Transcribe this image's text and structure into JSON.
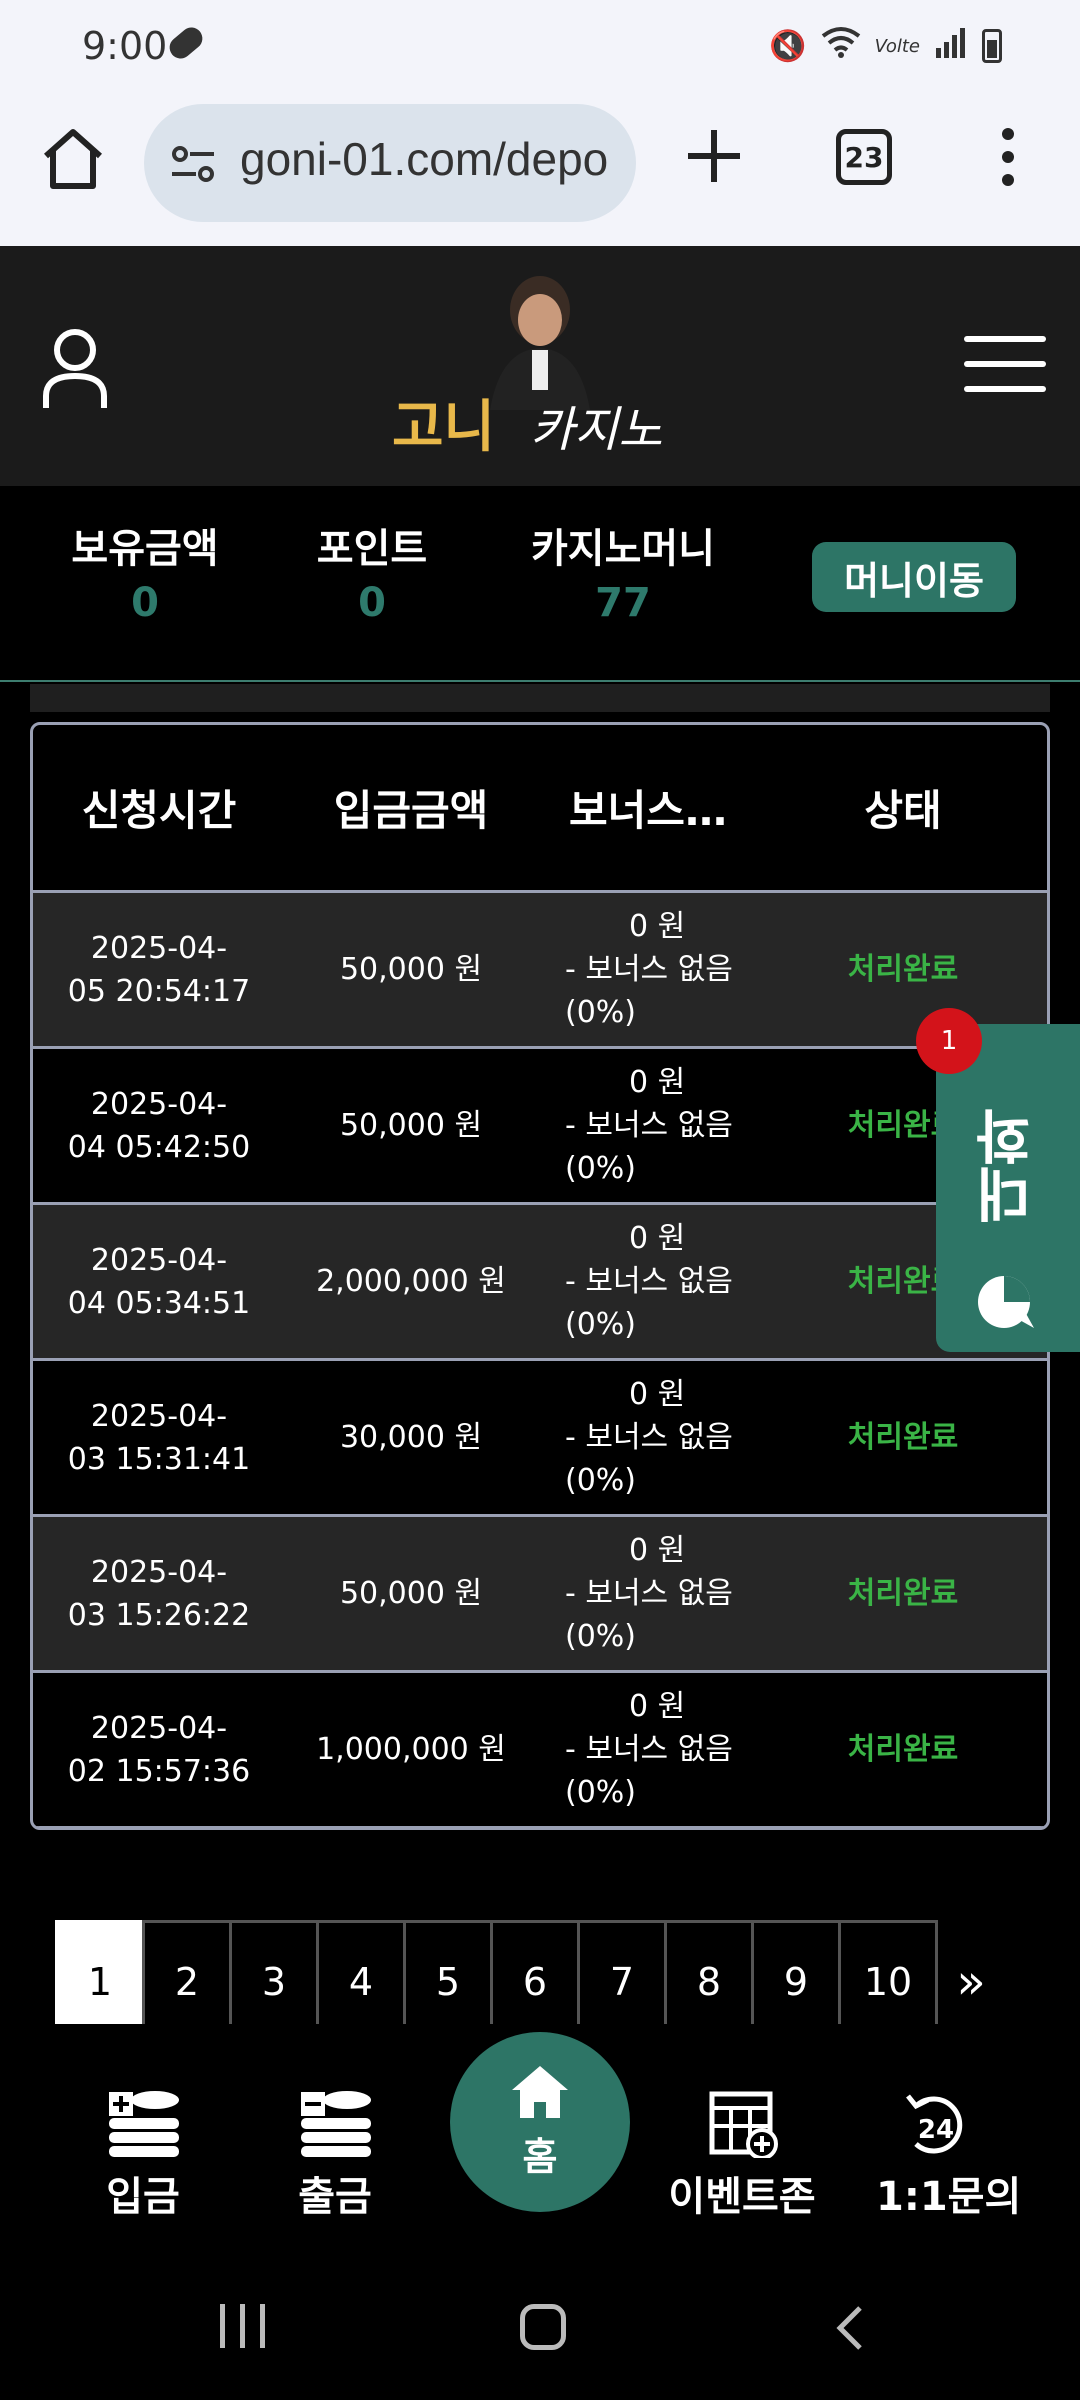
{
  "status_bar": {
    "time": "9:00",
    "right_text": "Volte"
  },
  "browser": {
    "url": "goni-01.com/depo",
    "tab_count": "23"
  },
  "site": {
    "logo_text_1": "고니",
    "logo_text_2": "카지노"
  },
  "balances": {
    "holding_label": "보유금액",
    "holding_value": "0",
    "point_label": "포인트",
    "point_value": "0",
    "casino_label": "카지노머니",
    "casino_value": "77",
    "move_button": "머니이동"
  },
  "table": {
    "headers": [
      "신청시간",
      "입금금액",
      "보너스…",
      "상태"
    ],
    "rows": [
      {
        "time1": "2025-04-",
        "time2": "05 20:54:17",
        "amount": "50,000 원",
        "bonus1": "0 원",
        "bonus2": "- 보너스 없음",
        "bonus3": "(0%)",
        "status": "처리완료"
      },
      {
        "time1": "2025-04-",
        "time2": "04 05:42:50",
        "amount": "50,000 원",
        "bonus1": "0 원",
        "bonus2": "- 보너스 없음",
        "bonus3": "(0%)",
        "status": "처리완료"
      },
      {
        "time1": "2025-04-",
        "time2": "04 05:34:51",
        "amount": "2,000,000 원",
        "bonus1": "0 원",
        "bonus2": "- 보너스 없음",
        "bonus3": "(0%)",
        "status": "처리완료"
      },
      {
        "time1": "2025-04-",
        "time2": "03 15:31:41",
        "amount": "30,000 원",
        "bonus1": "0 원",
        "bonus2": "- 보너스 없음",
        "bonus3": "(0%)",
        "status": "처리완료"
      },
      {
        "time1": "2025-04-",
        "time2": "03 15:26:22",
        "amount": "50,000 원",
        "bonus1": "0 원",
        "bonus2": "- 보너스 없음",
        "bonus3": "(0%)",
        "status": "처리완료"
      },
      {
        "time1": "2025-04-",
        "time2": "02 15:57:36",
        "amount": "1,000,000 원",
        "bonus1": "0 원",
        "bonus2": "- 보너스 없음",
        "bonus3": "(0%)",
        "status": "처리완료"
      }
    ]
  },
  "chat": {
    "label": "대화",
    "badge": "1"
  },
  "pagination": {
    "pages": [
      "1",
      "2",
      "3",
      "4",
      "5",
      "6",
      "7",
      "8",
      "9",
      "10"
    ],
    "current": "1",
    "next": "»"
  },
  "bottom_nav": {
    "deposit": "입금",
    "withdraw": "출금",
    "home": "홈",
    "event": "이벤트존",
    "inquiry": "1:1문의"
  },
  "colors": {
    "accent": "#2d7566",
    "status_done": "#3ab446",
    "badge": "#d3131a"
  }
}
